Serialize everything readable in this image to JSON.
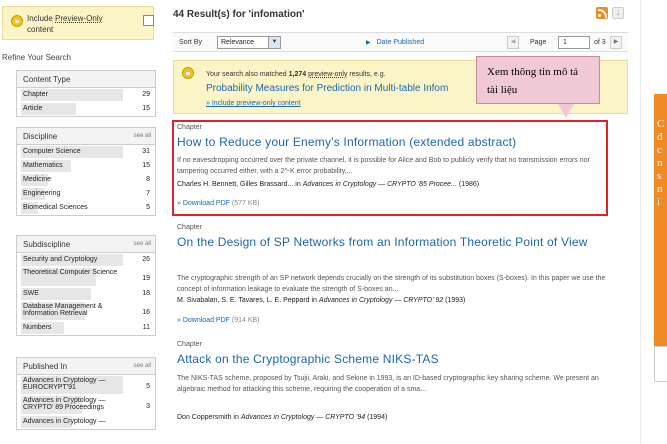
{
  "sidebar": {
    "preview_label_1": "Include",
    "preview_label_2": "Preview-Only",
    "preview_label_3": "content",
    "refine": "Refine Your Search",
    "facets": [
      {
        "title": "Content Type",
        "see_all": "",
        "items": [
          {
            "label": "Chapter",
            "count": "29",
            "fill": 1.0
          },
          {
            "label": "Article",
            "count": "15",
            "fill": 0.52
          }
        ]
      },
      {
        "title": "Discipline",
        "see_all": "see all",
        "items": [
          {
            "label": "Computer Science",
            "count": "31",
            "fill": 1.0
          },
          {
            "label": "Mathematics",
            "count": "15",
            "fill": 0.48
          },
          {
            "label": "Medicine",
            "count": "8",
            "fill": 0.26
          },
          {
            "label": "Engineering",
            "count": "7",
            "fill": 0.23
          },
          {
            "label": "Biomedical Sciences",
            "count": "5",
            "fill": 0.16
          }
        ]
      },
      {
        "title": "Subdiscipline",
        "see_all": "see all",
        "items": [
          {
            "label": "Security and Cryptology",
            "count": "26",
            "fill": 1.0
          },
          {
            "label": "Theoretical Computer Science",
            "count": "19",
            "fill": 0.73
          },
          {
            "label": "SWE",
            "count": "18",
            "fill": 0.69
          },
          {
            "label": "Database Management & Information Retrieval",
            "count": "16",
            "fill": 0.62
          },
          {
            "label": "Numbers",
            "count": "11",
            "fill": 0.42
          }
        ]
      },
      {
        "title": "Published In",
        "see_all": "see all",
        "items": [
          {
            "label": "Advances in Cryptology — EUROCRYPT'91",
            "count": "5",
            "fill": 1.0
          },
          {
            "label": "Advances in Cryptology — CRYPTO' 89 Proceedings",
            "count": "3",
            "fill": 0.6
          },
          {
            "label": "Advances in Cryptology —",
            "count": "",
            "fill": 0.5
          }
        ]
      }
    ]
  },
  "header": {
    "count": "44",
    "results_for": "Result(s) for",
    "query": "'infomation'"
  },
  "sortbar": {
    "sort_by": "Sort By",
    "sort_value": "Relevance",
    "date_published": "Date Published",
    "page_label": "Page",
    "page_value": "1",
    "of_label": "of 3"
  },
  "also": {
    "prefix": "Your search also matched",
    "count": "1,274",
    "preview_only": "preview-only",
    "suffix": "results, e.g.",
    "example_title": "Probability Measures for Prediction in Multi-table Infom",
    "include_link": "» Include preview-only content"
  },
  "callout": {
    "text": "Xem thông tin mô tả tài liệu"
  },
  "results": [
    {
      "type": "Chapter",
      "title": "How to Reduce your Enemy's Information (extended abstract)",
      "snippet": "If no eavesdropping occurred over the private channel, it is possible for Alice and Bob to publicly verify that no transmission errors nor tampering occurred either, with a 2^-K error probability,...",
      "authors": "Charles H. Bennett, Gilles Brassard... in",
      "venue": "Advances in Cryptology — CRYPTO '85 Procee...",
      "year": "(1986)",
      "pdf": "» Download PDF",
      "size": "(577 KB)"
    },
    {
      "type": "Chapter",
      "title": "On the Design of SP Networks from an Information Theoretic Point of View",
      "snippet": "The cryptographic strength of an SP network depends crucially on the strength of its substitution boxes (S-boxes). In this paper we use the concept of information leakage to evaluate the strength of S-boxes an...",
      "authors": "M. Sivabalan, S. E. Tavares, L. E. Peppard in",
      "venue": "Advances in Cryptology — CRYPTO' 92",
      "year": "(1993)",
      "pdf": "» Download PDF",
      "size": "(914 KB)"
    },
    {
      "type": "Chapter",
      "title": "Attack on the Cryptographic Scheme NIKS-TAS",
      "snippet": "The NIKS-TAS scheme, proposed by Tsujii, Araki, and Sekine in 1993, is an ID-based cryptographic key sharing scheme. We present an algebraic method for attacking this scheme, requiring the cooperation of a sma...",
      "authors": "Don Coppersmith in",
      "venue": "Advances in Cryptology — CRYPTO '94",
      "year": "(1994)"
    }
  ],
  "right_panel": {
    "text": "C đ c n s n i"
  }
}
